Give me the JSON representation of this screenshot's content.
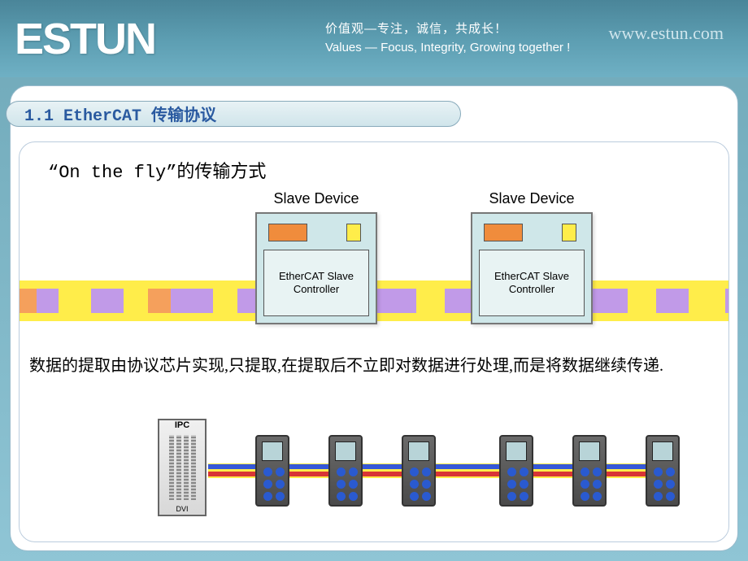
{
  "header": {
    "logo_text": "ESTUN",
    "tagline_cn": "价值观—专注，诚信，共成长！",
    "tagline_en": "Values — Focus, Integrity, Growing together !",
    "url": "www.estun.com"
  },
  "section": {
    "title": "1.1 EtherCAT 传输协议",
    "subtitle": "“On the fly”的传输方式"
  },
  "slave": {
    "label": "Slave Device",
    "controller": "EtherCAT Slave Controller"
  },
  "description": "数据的提取由协议芯片实现,只提取,在提取后不立即对数据进行处理,而是将数据继续传递.",
  "ipc": {
    "label": "IPC",
    "port": "DVI"
  }
}
